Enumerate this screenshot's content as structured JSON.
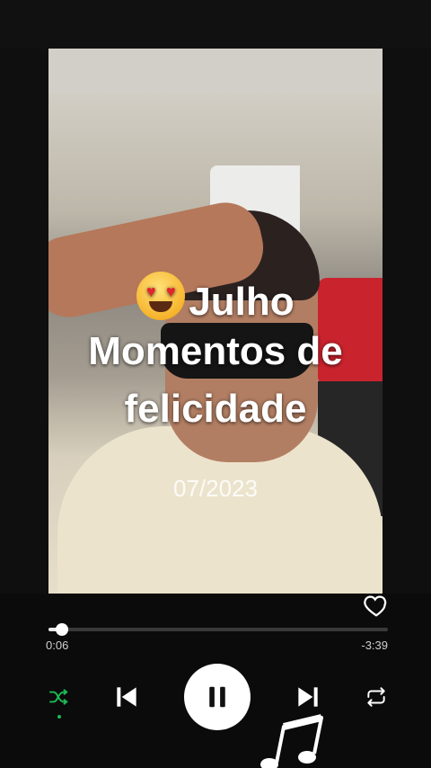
{
  "cover": {
    "title_line1": "Julho",
    "title_line2": "Momentos de",
    "title_line3": "felicidade",
    "date": "07/2023",
    "emoji": "heart-eyes-emoji"
  },
  "player": {
    "elapsed": "0:06",
    "remaining": "-3:39",
    "progress_fraction": 0.04,
    "shuffle_active": true,
    "accent": "#1db954",
    "icons": [
      "heart-icon",
      "shuffle-icon",
      "previous-icon",
      "pause-icon",
      "next-icon",
      "repeat-icon",
      "music-note-icon"
    ]
  }
}
